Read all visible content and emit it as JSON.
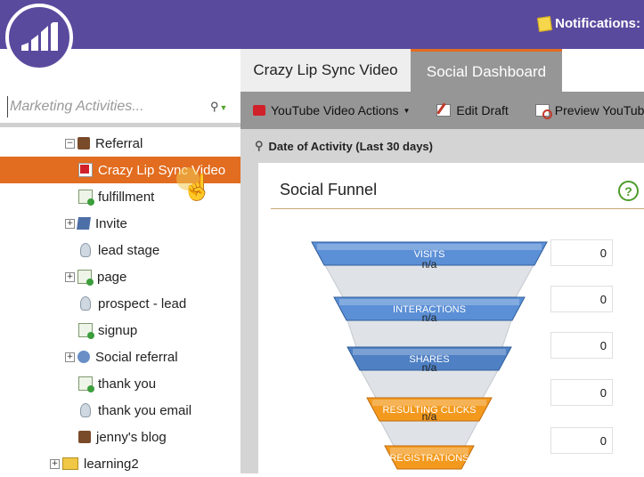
{
  "header": {
    "notifications_label": "Notifications:"
  },
  "left_pane": {
    "search_placeholder": "Marketing Activities...",
    "tree": [
      {
        "label": "Referral",
        "icon": "program-box-icon",
        "expander": "⊟",
        "indent": 1
      },
      {
        "label": "Crazy Lip Sync Video",
        "icon": "video-icon",
        "selected": true,
        "indent": 2
      },
      {
        "label": "fulfillment",
        "icon": "form-icon",
        "indent": 2
      },
      {
        "label": "Invite",
        "icon": "email-program-icon",
        "expander": "⊞",
        "indent": 2
      },
      {
        "label": "lead stage",
        "icon": "smart-campaign-icon",
        "indent": 2
      },
      {
        "label": "page",
        "icon": "landing-page-icon",
        "expander": "⊞",
        "indent": 2
      },
      {
        "label": "prospect - lead",
        "icon": "smart-campaign-icon",
        "indent": 2
      },
      {
        "label": "signup",
        "icon": "form-icon",
        "indent": 2
      },
      {
        "label": "Social referral",
        "icon": "social-program-icon",
        "expander": "⊞",
        "indent": 2
      },
      {
        "label": "thank you",
        "icon": "form-icon",
        "indent": 2
      },
      {
        "label": "thank you email",
        "icon": "smart-campaign-icon",
        "indent": 2
      },
      {
        "label": "jenny's blog",
        "icon": "program-box-icon",
        "indent": 1
      },
      {
        "label": "learning2",
        "icon": "folder-icon",
        "expander": "⊞",
        "indent": 0
      }
    ]
  },
  "tabs": [
    {
      "label": "Crazy Lip Sync Video",
      "active": false
    },
    {
      "label": "Social Dashboard",
      "active": true
    }
  ],
  "toolbar": {
    "youtube_actions": "YouTube Video Actions",
    "edit_draft": "Edit Draft",
    "preview": "Preview YouTube"
  },
  "filter": {
    "date_label": "Date of Activity (Last 30 days)"
  },
  "social_funnel": {
    "title": "Social Funnel",
    "help_icon": "?",
    "stages": [
      {
        "label": "VISITS",
        "value": "0",
        "color": "#5b8fd6"
      },
      {
        "label": "INTERACTIONS",
        "value": "0",
        "color": "#5b8fd6"
      },
      {
        "label": "SHARES",
        "value": "0",
        "color": "#4f80c4"
      },
      {
        "label": "RESULTING CLICKS",
        "value": "0",
        "color": "#f39a1e"
      },
      {
        "label": "REGISTRATIONS",
        "value": "0",
        "color": "#f39a1e"
      }
    ],
    "conversion_rates": [
      "n/a",
      "n/a",
      "n/a",
      "n/a"
    ]
  },
  "colors": {
    "header_purple": "#5a4a9e",
    "selection_orange": "#e26c1f",
    "accent_green": "#4d9c2b"
  }
}
